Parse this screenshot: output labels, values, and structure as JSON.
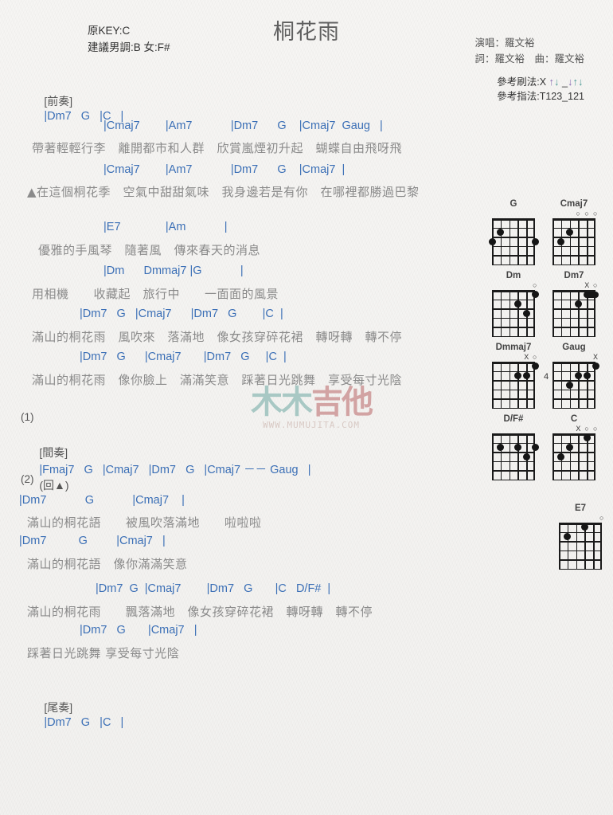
{
  "header": {
    "title": "桐花雨",
    "key_original": "原KEY:C",
    "key_suggest": "建議男調:B 女:F#",
    "singer": "演唱：羅文裕",
    "writer": "詞：羅文裕　曲：羅文裕",
    "strum_label": "參考刷法:X",
    "strum_pattern": "↑↓ _↓↑↓",
    "pick_label": "參考指法:T123_121"
  },
  "watermark": {
    "text_left": "木木",
    "text_right": "吉他",
    "url": "WWW.MUMUJITA.COM"
  },
  "sections": {
    "intro_label": "[前奏]",
    "intro_chords": "|Dm7   G   |C   |",
    "interlude_label": "[間奏]",
    "outro_label": "[尾奏]",
    "outro_chords": "|Dm7   G   |C   |",
    "num1": "(1)",
    "num2": "(2)",
    "repeat_mark": "(回▲)"
  },
  "lines": [
    {
      "chords": "|Cmaj7        |Am7            |Dm7      G    |Cmaj7  Gaug   |",
      "lyrics": "帶著輕輕行李　離開都市和人群　欣賞嵐煙初升起　蝴蝶自由飛呀飛"
    },
    {
      "chords": "|Cmaj7        |Am7            |Dm7      G    |Cmaj7  |",
      "lyrics": "▲在這個桐花季　空氣中甜甜氣味　我身邊若是有你　在哪裡都勝過巴黎"
    },
    {
      "chords": "|E7              |Am            |",
      "lyrics": "優雅的手風琴　隨著風　傳來春天的消息"
    },
    {
      "chords": "|Dm      Dmmaj7 |G            |",
      "lyrics": "用相機　　收藏起　旅行中　　一面面的風景"
    },
    {
      "chords": "|Dm7   G   |Cmaj7      |Dm7   G        |C  |",
      "lyrics": "滿山的桐花雨　風吹來　落滿地　像女孩穿碎花裙　轉呀轉　轉不停"
    },
    {
      "chords": "|Dm7   G      |Cmaj7       |Dm7   G     |C  |",
      "lyrics": "滿山的桐花雨　像你臉上　滿滿笑意　踩著日光跳舞　享受每寸光陰"
    },
    {
      "chords": "|Fmaj7   G   |Cmaj7   |Dm7   G   |Cmaj7 －－ Gaug   |",
      "lyrics": ""
    },
    {
      "chords": "|Dm7            G            |Cmaj7    |",
      "lyrics": "滿山的桐花語　　被風吹落滿地　　啦啦啦"
    },
    {
      "chords": "|Dm7          G         |Cmaj7   |",
      "lyrics": "滿山的桐花語　像你滿滿笑意"
    },
    {
      "chords": "|Dm7  G  |Cmaj7        |Dm7   G       |C   D/F#  |",
      "lyrics": "滿山的桐花雨　　飄落滿地　像女孩穿碎花裙　轉呀轉　轉不停"
    },
    {
      "chords": "|Dm7   G       |Cmaj7   |",
      "lyrics": "踩著日光跳舞 享受每寸光陰"
    }
  ],
  "chord_diagrams": [
    {
      "name": "G",
      "markers": "",
      "fret_label": "",
      "dots": [
        [
          6,
          3
        ],
        [
          5,
          2
        ],
        [
          1,
          3
        ]
      ],
      "barre": null
    },
    {
      "name": "Cmaj7",
      "markers": "ooo",
      "fret_label": "",
      "dots": [
        [
          5,
          3
        ],
        [
          4,
          2
        ]
      ],
      "barre": null
    },
    {
      "name": "Dm",
      "markers": "o",
      "fret_label": "",
      "dots": [
        [
          1,
          1
        ],
        [
          3,
          2
        ],
        [
          2,
          3
        ]
      ],
      "barre": null
    },
    {
      "name": "Dm7",
      "markers": "Xo",
      "fret_label": "",
      "dots": [
        [
          3,
          2
        ]
      ],
      "barre": [
        1,
        2,
        1
      ]
    },
    {
      "name": "Dmmaj7",
      "markers": "Xo",
      "fret_label": "",
      "dots": [
        [
          1,
          1
        ],
        [
          2,
          2
        ],
        [
          3,
          2
        ]
      ],
      "barre": null
    },
    {
      "name": "Gaug",
      "markers": "X",
      "fret_label": "4",
      "dots": [
        [
          1,
          1
        ],
        [
          2,
          2
        ],
        [
          3,
          2
        ],
        [
          4,
          3
        ]
      ],
      "barre": null
    },
    {
      "name": "D/F#",
      "markers": "",
      "fret_label": "",
      "dots": [
        [
          5,
          2
        ],
        [
          3,
          2
        ],
        [
          1,
          2
        ],
        [
          2,
          3
        ]
      ],
      "barre": null
    },
    {
      "name": "C",
      "markers": "Xoo",
      "fret_label": "",
      "dots": [
        [
          2,
          1
        ],
        [
          4,
          2
        ],
        [
          5,
          3
        ]
      ],
      "barre": null
    },
    {
      "name": "E7",
      "markers": "o",
      "fret_label": "",
      "dots": [
        [
          5,
          2
        ],
        [
          3,
          1
        ]
      ],
      "barre": null
    }
  ]
}
